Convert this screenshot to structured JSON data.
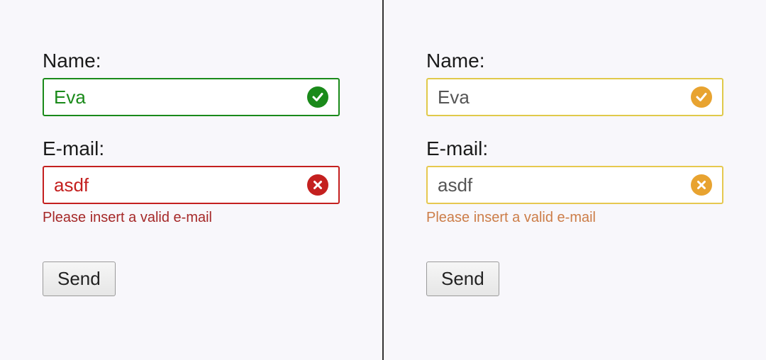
{
  "left": {
    "name_label": "Name:",
    "name_value": "Eva",
    "email_label": "E-mail:",
    "email_value": "asdf",
    "email_error": "Please insert a valid e-mail",
    "send_label": "Send",
    "colors": {
      "valid": "#1a8a1a",
      "invalid": "#c4201f",
      "error_text": "#a52828"
    }
  },
  "right": {
    "name_label": "Name:",
    "name_value": "Eva",
    "email_label": "E-mail:",
    "email_value": "asdf",
    "email_error": "Please insert a valid e-mail",
    "send_label": "Send",
    "colors": {
      "valid": "#e8a330",
      "invalid": "#e8a330",
      "error_text": "#cc7d48"
    }
  }
}
